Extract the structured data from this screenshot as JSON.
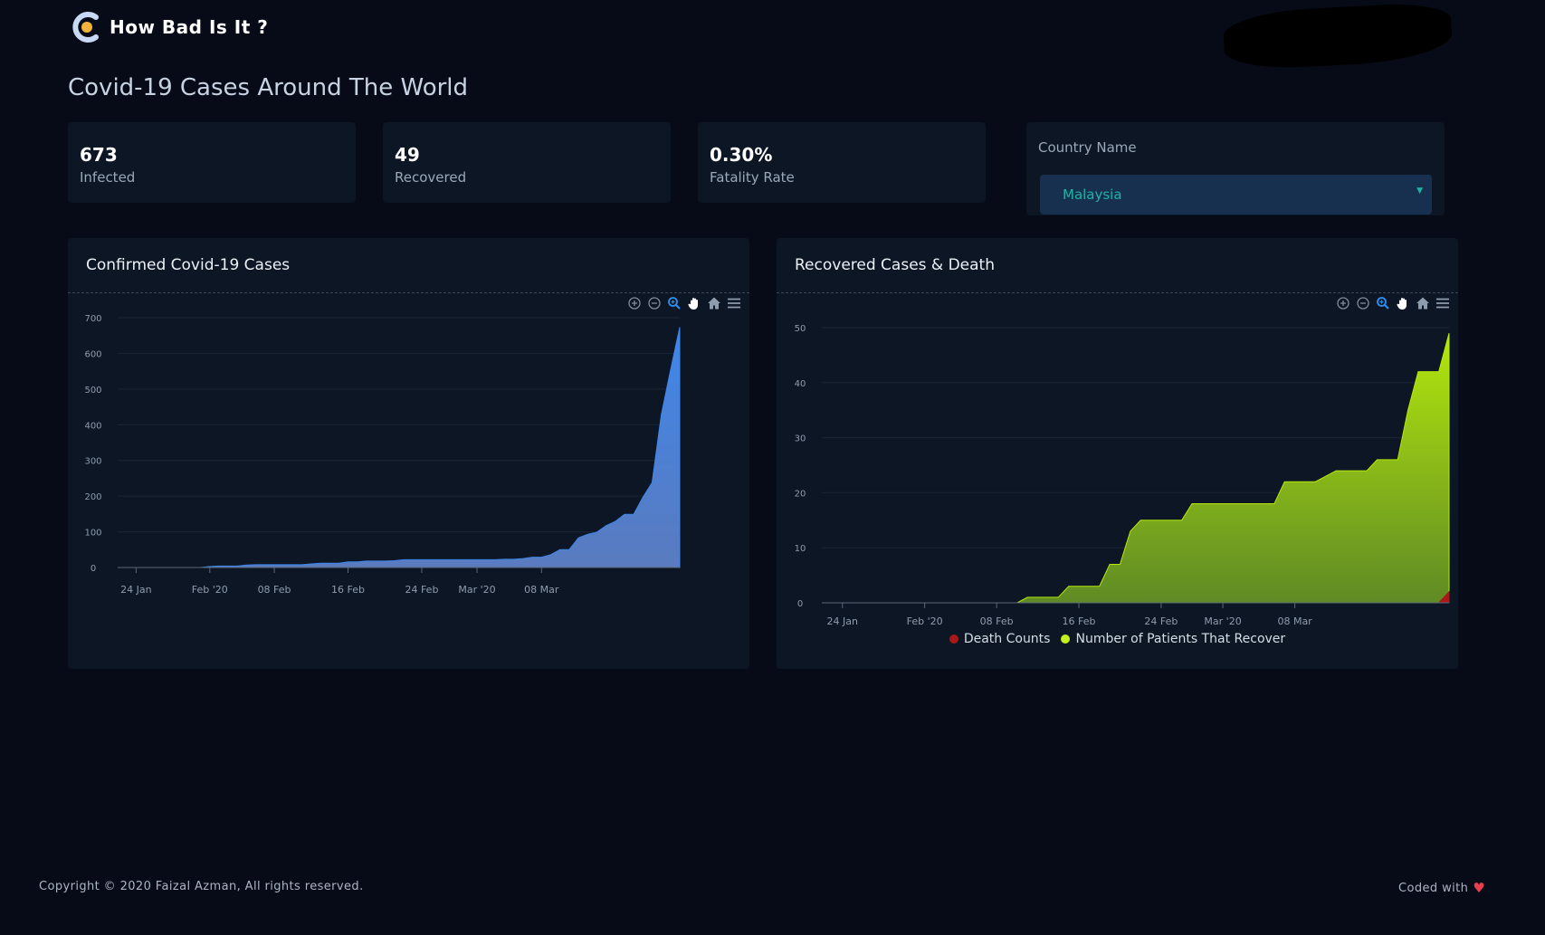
{
  "header": {
    "brand": "How Bad Is It ?"
  },
  "page_title": "Covid-19 Cases Around The World",
  "stats": [
    {
      "value": "673",
      "label": "Infected"
    },
    {
      "value": "49",
      "label": "Recovered"
    },
    {
      "value": "0.30%",
      "label": "Fatality Rate"
    }
  ],
  "country": {
    "label": "Country Name",
    "selected": "Malaysia"
  },
  "colors": {
    "confirmed_top": "#3f86ea",
    "confirmed_bottom": "#5a7bbf",
    "recovered_top": "#b4e80d",
    "recovered_bottom": "#5f8a25",
    "death": "#a81818"
  },
  "toolbar_icons": [
    "zoom-in-icon",
    "zoom-out-icon",
    "selection-zoom-icon",
    "pan-hand-icon",
    "reset-home-icon",
    "menu-icon"
  ],
  "chart_data": [
    {
      "type": "area",
      "title": "Confirmed Covid-19 Cases",
      "ylim": [
        0,
        700
      ],
      "yticks": [
        0,
        100,
        200,
        300,
        400,
        500,
        600,
        700
      ],
      "x_start": "2020-01-22",
      "x_end": "2020-03-23",
      "xticks": [
        {
          "date": "2020-01-24",
          "label": "24 Jan"
        },
        {
          "date": "2020-02-01",
          "label": "Feb '20"
        },
        {
          "date": "2020-02-08",
          "label": "08 Feb"
        },
        {
          "date": "2020-02-16",
          "label": "16 Feb"
        },
        {
          "date": "2020-02-24",
          "label": "24 Feb"
        },
        {
          "date": "2020-03-01",
          "label": "Mar '20"
        },
        {
          "date": "2020-03-08",
          "label": "08 Mar"
        }
      ],
      "series": [
        {
          "values": [
            0,
            0,
            3,
            4,
            4,
            4,
            7,
            8,
            8,
            8,
            8,
            8,
            8,
            10,
            12,
            12,
            12,
            16,
            16,
            18,
            18,
            18,
            19,
            22,
            22,
            22,
            22,
            22,
            22,
            22,
            22,
            22,
            22,
            22,
            23,
            23,
            25,
            29,
            29,
            36,
            50,
            50,
            83,
            93,
            99,
            117,
            129,
            149,
            149,
            197,
            238,
            428,
            553,
            673
          ]
        }
      ]
    },
    {
      "type": "area",
      "title": "Recovered Cases & Death",
      "ylim": [
        0,
        50
      ],
      "yticks": [
        0,
        10,
        20,
        30,
        40,
        50
      ],
      "x_start": "2020-01-22",
      "x_end": "2020-03-23",
      "xticks": [
        {
          "date": "2020-01-24",
          "label": "24 Jan"
        },
        {
          "date": "2020-02-01",
          "label": "Feb '20"
        },
        {
          "date": "2020-02-08",
          "label": "08 Feb"
        },
        {
          "date": "2020-02-16",
          "label": "16 Feb"
        },
        {
          "date": "2020-02-24",
          "label": "24 Feb"
        },
        {
          "date": "2020-03-01",
          "label": "Mar '20"
        },
        {
          "date": "2020-03-08",
          "label": "08 Mar"
        }
      ],
      "series": [
        {
          "name": "Death Counts",
          "values": [
            0,
            0,
            0,
            0,
            0,
            0,
            0,
            0,
            0,
            0,
            0,
            0,
            0,
            0,
            0,
            0,
            0,
            0,
            0,
            0,
            0,
            0,
            0,
            0,
            0,
            0,
            0,
            0,
            0,
            0,
            0,
            0,
            0,
            0,
            0,
            0,
            0,
            0,
            0,
            0,
            0,
            0,
            0,
            0,
            0,
            0,
            0,
            0,
            0,
            0,
            0,
            0,
            0,
            2
          ]
        },
        {
          "name": "Number of Patients That Recover",
          "values": [
            0,
            0,
            0,
            0,
            0,
            0,
            0,
            0,
            0,
            0,
            0,
            0,
            0,
            0,
            0,
            0,
            1,
            1,
            1,
            1,
            3,
            3,
            3,
            3,
            7,
            7,
            13,
            15,
            15,
            15,
            15,
            15,
            18,
            18,
            18,
            18,
            18,
            18,
            18,
            18,
            18,
            22,
            22,
            22,
            22,
            23,
            24,
            24,
            24,
            24,
            26,
            26,
            26,
            35,
            42,
            42,
            42,
            49
          ]
        }
      ],
      "legend": [
        "Death Counts",
        "Number of Patients That Recover"
      ]
    }
  ],
  "footer": {
    "copyright": "Copyright © 2020 Faizal Azman, All rights reserved.",
    "coded_with": "Coded with"
  }
}
